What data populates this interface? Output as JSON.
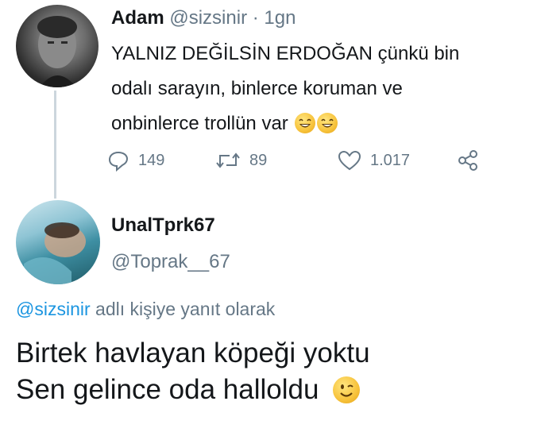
{
  "tweet": {
    "author_name": "Adam",
    "handle": "@sizsinir",
    "separator": "·",
    "time": "1gn",
    "lines": [
      "YALNIZ DEĞİLSİN ERDOĞAN çünkü bin",
      "odalı sarayın, binlerce koruman ve",
      "onbinlerce trollün var"
    ],
    "emojis": [
      "laughing-emoji",
      "laughing-emoji"
    ],
    "stats": {
      "replies": "149",
      "retweets": "89",
      "likes": "1.017"
    },
    "icons": {
      "reply": "reply-icon",
      "retweet": "retweet-icon",
      "like": "heart-icon",
      "share": "share-icon"
    }
  },
  "reply": {
    "author_name": "UnalTprk67",
    "handle": "@Toprak__67",
    "replying_to_handle": "@sizsinir",
    "replying_to_suffix": " adlı kişiye yanıt olarak",
    "lines": [
      "Birtek havlayan köpeği yoktu",
      "Sen gelince oda halloldu"
    ],
    "emoji": "winking-emoji"
  },
  "colors": {
    "text": "#14171a",
    "secondary": "#657786",
    "link": "#1b95e0",
    "thread_line": "#ccd6dd"
  }
}
